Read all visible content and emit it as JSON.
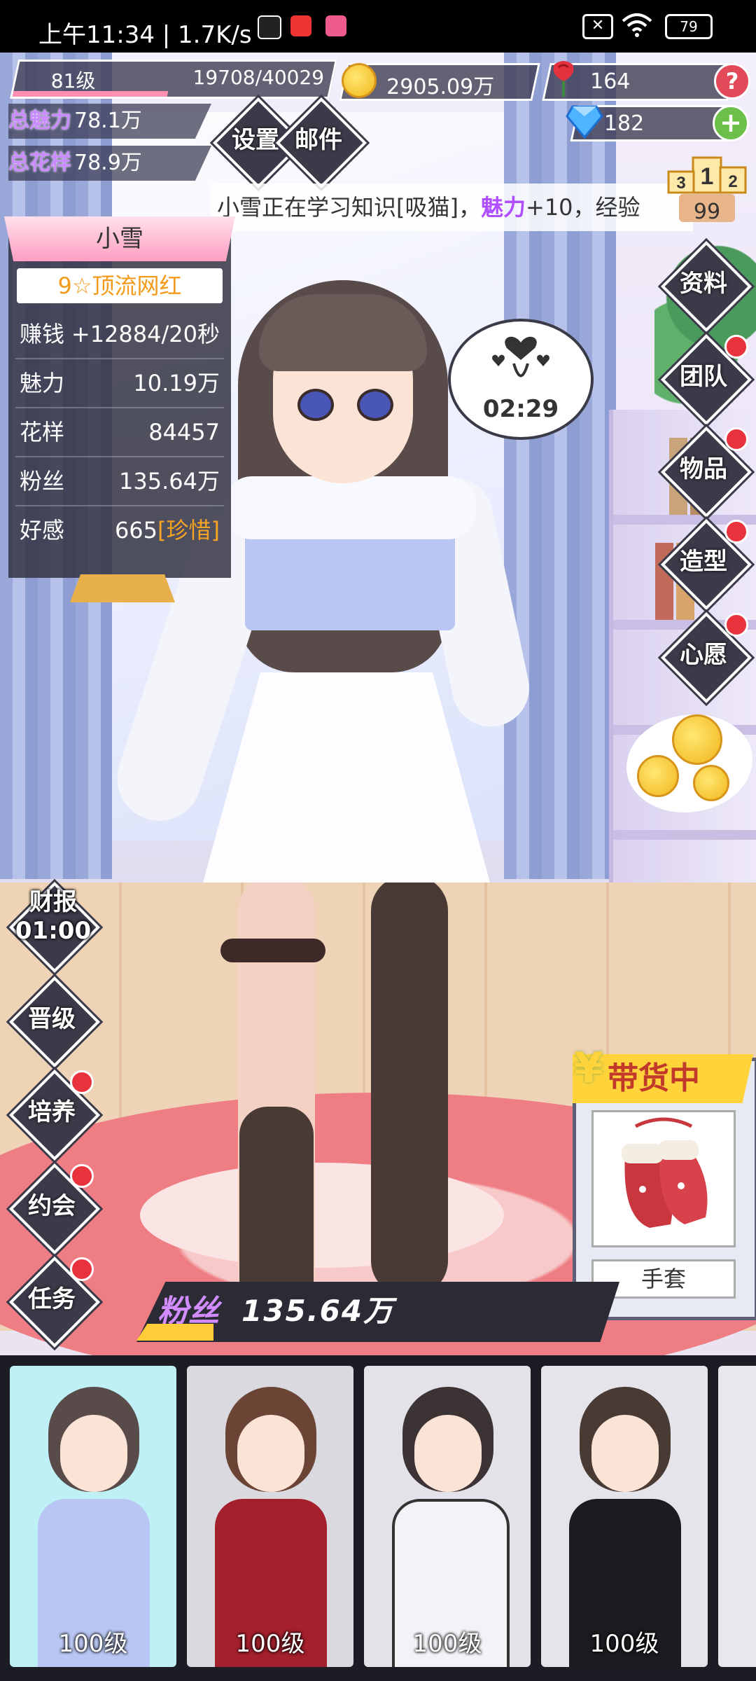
{
  "status_bar": {
    "time_speed": "上午11:34 | 1.7K/s",
    "battery": "79"
  },
  "hud": {
    "level": "81级",
    "exp": "19708/40029",
    "exp_progress": 0.49,
    "gold": "2905.09万",
    "roses": "164",
    "diamonds": "182",
    "help": "?",
    "add": "+",
    "total_charm_label": "总魅力",
    "total_charm_value": "78.1万",
    "total_pattern_label": "总花样",
    "total_pattern_value": "78.9万",
    "settings_label": "设置",
    "mail_label": "邮件",
    "rank_number": "99"
  },
  "ticker": {
    "pre": "小雪正在学习知识[吸猫]，",
    "highlight": "魅力",
    "post": "+10，经验"
  },
  "character": {
    "name": "小雪",
    "title": "9☆顶流网红",
    "stats": [
      {
        "key": "赚钱",
        "value": "+12884/20秒"
      },
      {
        "key": "魅力",
        "value": "10.19万"
      },
      {
        "key": "花样",
        "value": "84457"
      },
      {
        "key": "粉丝",
        "value": "135.64万"
      }
    ],
    "affinity_key": "好感",
    "affinity_value": "665",
    "affinity_tag": "珍惜",
    "timer": "02:29"
  },
  "right_menu": [
    "资料",
    "团队",
    "物品",
    "造型",
    "心愿"
  ],
  "left_menu": {
    "report": "财报",
    "report_timer": "01:00",
    "items": [
      "晋级",
      "培养",
      "约会",
      "任务"
    ]
  },
  "selling": {
    "yen": "¥",
    "title": "带货中",
    "item_name": "手套"
  },
  "fans": {
    "label": "粉丝",
    "value": "135.64万",
    "progress": 0.16
  },
  "cards": [
    {
      "level": "100级",
      "color": "#bff0f5"
    },
    {
      "level": "100级",
      "color": "#d9d9df"
    },
    {
      "level": "100级",
      "color": "#e2e2e8"
    },
    {
      "level": "100级",
      "color": "#e4e4ea"
    }
  ],
  "colors": {
    "charm_purple": "#b04fff",
    "gold": "#f7a324",
    "badge_red": "#e8323c"
  }
}
